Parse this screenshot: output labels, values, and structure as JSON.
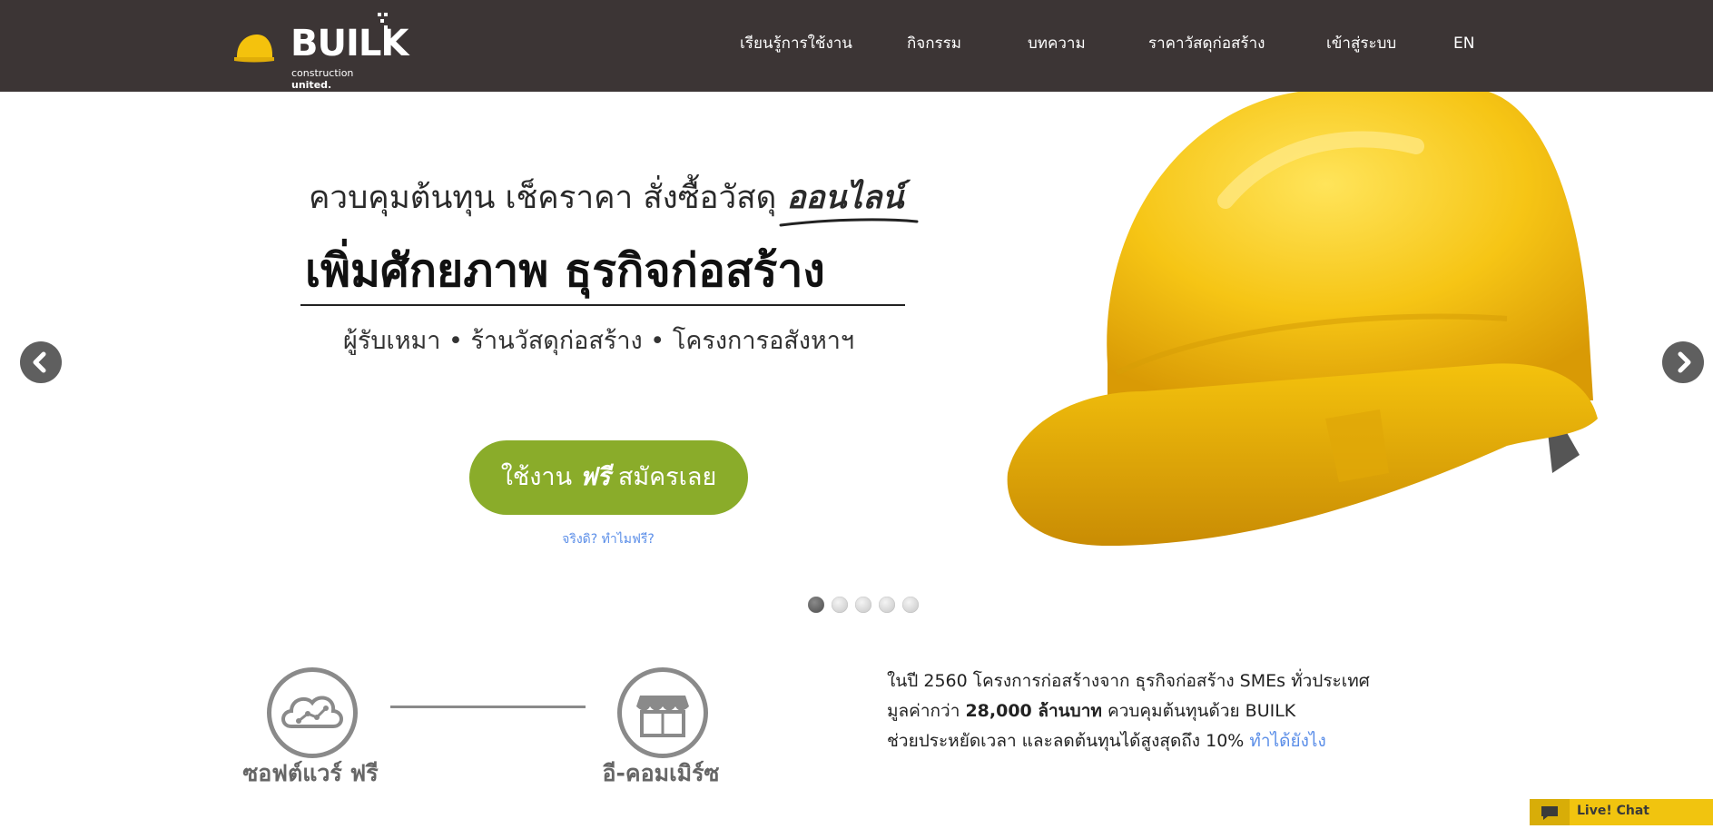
{
  "nav": {
    "logo": {
      "word": "BUILK",
      "tagline_prefix": "construction",
      "tagline_suffix": "united."
    },
    "items": [
      {
        "label": "เรียนรู้การใช้งาน"
      },
      {
        "label": "กิจกรรม"
      },
      {
        "label": "บทความ"
      },
      {
        "label": "ราคาวัสดุก่อสร้าง"
      },
      {
        "label": "เข้าสู่ระบบ"
      },
      {
        "label": "EN"
      }
    ]
  },
  "hero": {
    "tagline_main": "ควบคุมต้นทุน เช็คราคา สั่งซื้อวัสดุ",
    "tagline_highlight": "ออนไลน์",
    "headline_part1": "เพิ่มศักยภาพ",
    "headline_part2": "ธุรกิจก่อสร้าง",
    "subline": "ผู้รับเหมา • ร้านวัสดุก่อสร้าง • โครงการอสังหาฯ",
    "cta_part1": "ใช้งาน",
    "cta_free": "ฟรี",
    "cta_part2": "สมัครเลย",
    "why_link": "จริงดิ? ทำไมฟรี?",
    "slide_count": 5,
    "active_slide": 1
  },
  "features": [
    {
      "label": "ซอฟต์แวร์ ฟรี",
      "icon": "cloud-chart-icon"
    },
    {
      "label": "อี-คอมเมิร์ซ",
      "icon": "storefront-icon"
    }
  ],
  "stats": {
    "line1": "ในปี 2560 โครงการก่อสร้างจาก ธุรกิจก่อสร้าง SMEs ทั่วประเทศ",
    "line2_pre": "มูลค่ากว่า",
    "line2_bold": "28,000 ล้านบาท",
    "line2_post": "ควบคุมต้นทุนด้วย BUILK",
    "line3": "ช่วยประหยัดเวลา และลดต้นทุนได้สูงสุดถึง 10%",
    "link": "ทำได้ยังไง"
  },
  "livechat": {
    "label": "Live! Chat"
  },
  "colors": {
    "nav_bg": "#3c3535",
    "cta_green": "#8aac2a",
    "link_blue": "#5b8ee8",
    "helmet_yellow": "#f4c20d"
  }
}
